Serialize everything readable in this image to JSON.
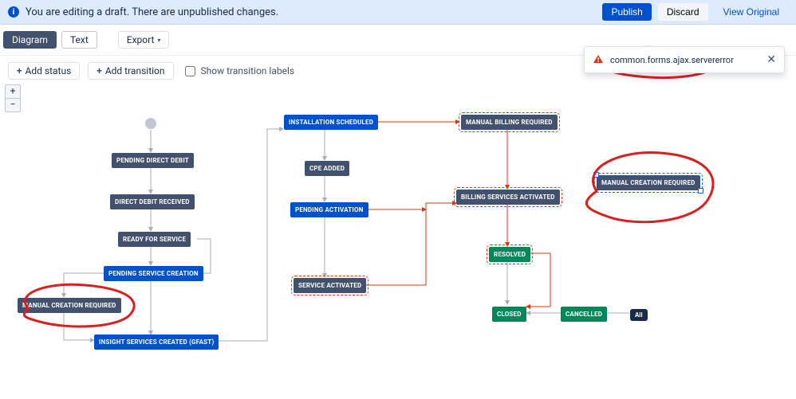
{
  "banner": {
    "message": "You are editing a draft. There are unpublished changes.",
    "publish": "Publish",
    "discard": "Discard",
    "view_original": "View Original"
  },
  "toolbar1": {
    "tab_diagram": "Diagram",
    "tab_text": "Text",
    "export": "Export"
  },
  "toolbar2": {
    "add_status": "Add status",
    "add_transition": "Add transition",
    "show_labels": "Show transition labels"
  },
  "zoom": {
    "in": "+",
    "out": "−"
  },
  "nodes": {
    "pending_direct_debit": "PENDING DIRECT DEBIT",
    "direct_debit_received": "DIRECT DEBIT RECEIVED",
    "ready_for_service": "READY FOR SERVICE",
    "pending_service_creation": "PENDING SERVICE CREATION",
    "manual_creation_required_1": "MANUAL CREATION REQUIRED",
    "insight_services_created": "INSIGHT SERVICES CREATED (GFAST)",
    "installation_scheduled": "INSTALLATION SCHEDULED",
    "cpe_added": "CPE ADDED",
    "pending_activation": "PENDING ACTIVATION",
    "service_activated": "SERVICE ACTIVATED",
    "manual_billing_required": "MANUAL BILLING REQUIRED",
    "billing_services_activated": "BILLING SERVICES ACTIVATED",
    "resolved": "RESOLVED",
    "closed": "CLOSED",
    "cancelled": "CANCELLED",
    "manual_creation_required_2": "MANUAL CREATION REQUIRED",
    "all_pill": "All"
  },
  "toast": {
    "message": "common.forms.ajax.servererror"
  },
  "colors": {
    "red": "#de350b",
    "blue": "#0052cc",
    "green": "#00875a",
    "neutral": "#42526e",
    "annotation": "#d92020"
  }
}
